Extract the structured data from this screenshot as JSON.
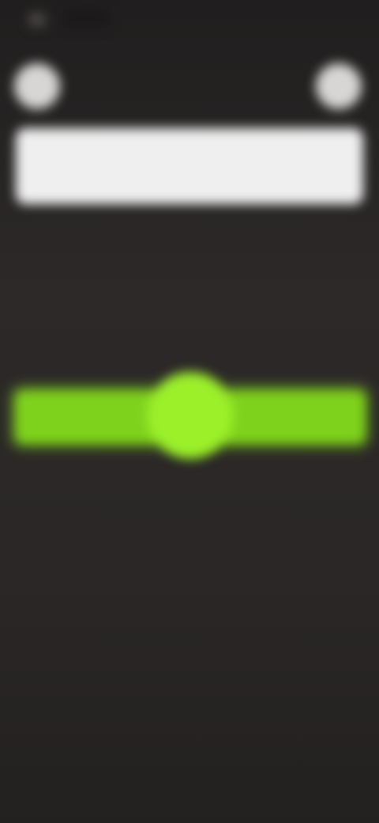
{
  "header": {
    "left_icon": "circle-icon",
    "right_icon": "circle-icon"
  },
  "search": {
    "label": ""
  },
  "slider": {
    "value": 0.5,
    "accent_color": "#7ed21c",
    "thumb_color": "#9bf02a"
  },
  "colors": {
    "background": "#2b2827",
    "bar": "#efefef"
  }
}
